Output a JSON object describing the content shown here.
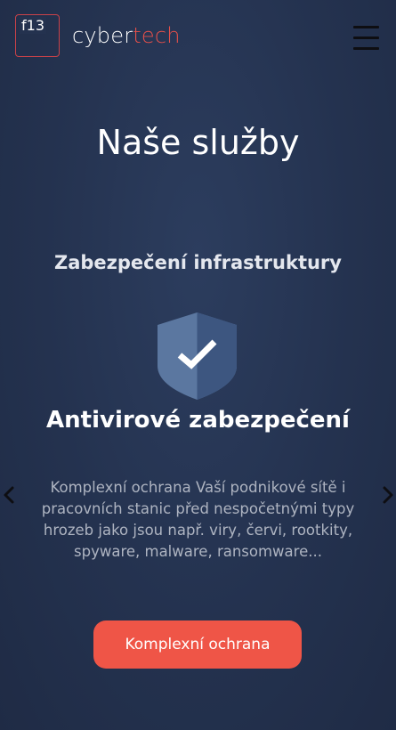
{
  "header": {
    "logo_mark": "f13",
    "logo_word_part1": "cyber",
    "logo_word_part2": "tech",
    "brand_color": "#e8504a",
    "menu_icon": "hamburger-menu-icon"
  },
  "main": {
    "title": "Naše služby",
    "section_title": "Zabezpečení infrastruktury",
    "card": {
      "icon": "shield-check-icon",
      "title": "Antivirové zabezpečení",
      "description": "Komplexní ochrana Vaší podnikové sítě i pracovních stanic před nespočetnými typy hrozeb jako jsou např. viry, červi, rootkity, spyware, malware, ransomware...",
      "button_label": "Komplexní ochrana"
    },
    "carousel": {
      "prev_icon": "chevron-left-icon",
      "next_icon": "chevron-right-icon"
    }
  },
  "colors": {
    "background": "#24324f",
    "accent": "#ef5547",
    "shield_light": "#5b77a0",
    "shield_dark": "#3d5680"
  }
}
